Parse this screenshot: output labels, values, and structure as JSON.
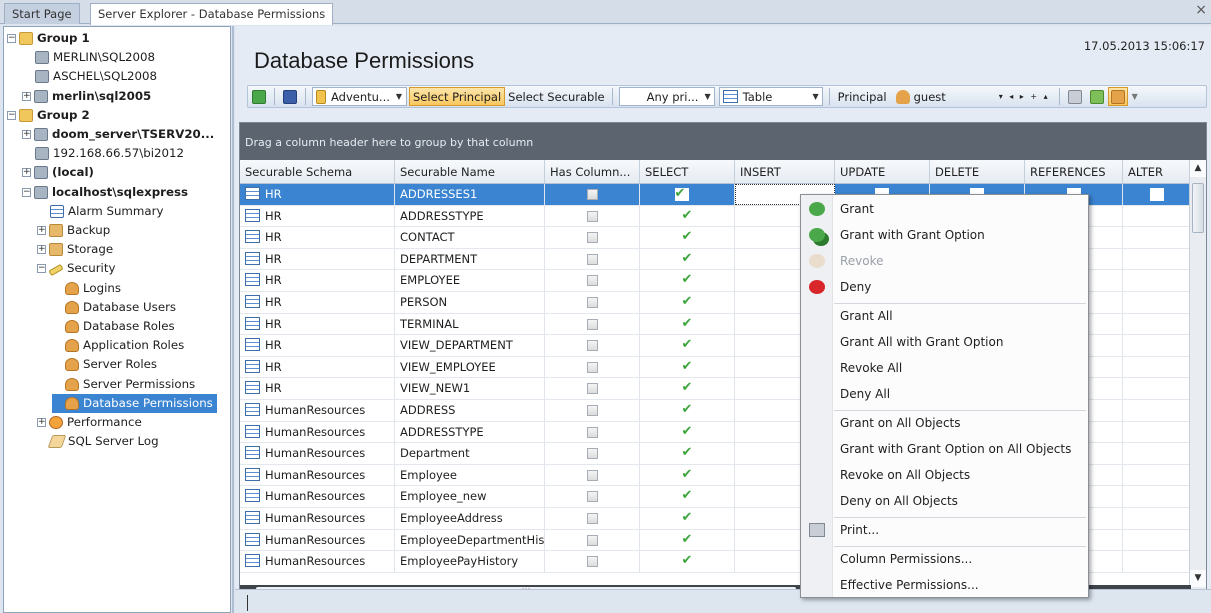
{
  "tabs": [
    {
      "label": "Start Page",
      "active": false
    },
    {
      "label": "Server Explorer - Database Permissions",
      "active": true
    }
  ],
  "tab_close_icon": "×",
  "tree": [
    {
      "label": "Group 1",
      "level": 0,
      "icon": "folder",
      "bold": true,
      "exp": "−"
    },
    {
      "label": "MERLIN\\SQL2008",
      "level": 1,
      "icon": "server",
      "bold": false,
      "exp": ""
    },
    {
      "label": "ASCHEL\\SQL2008",
      "level": 1,
      "icon": "server",
      "bold": false,
      "exp": ""
    },
    {
      "label": "merlin\\sql2005",
      "level": 1,
      "icon": "server",
      "bold": true,
      "exp": "+"
    },
    {
      "label": "Group 2",
      "level": 0,
      "icon": "folder",
      "bold": true,
      "exp": "−"
    },
    {
      "label": "doom_server\\TSERV20...",
      "level": 1,
      "icon": "server",
      "bold": true,
      "exp": "+"
    },
    {
      "label": "192.168.66.57\\bi2012",
      "level": 1,
      "icon": "server",
      "bold": false,
      "exp": ""
    },
    {
      "label": "(local)",
      "level": 1,
      "icon": "server",
      "bold": true,
      "exp": "+"
    },
    {
      "label": "localhost\\sqlexpress",
      "level": 1,
      "icon": "server",
      "bold": true,
      "exp": "−"
    },
    {
      "label": "Alarm Summary",
      "level": 2,
      "icon": "grid",
      "bold": false,
      "exp": ""
    },
    {
      "label": "Backup",
      "level": 2,
      "icon": "dbfold",
      "bold": false,
      "exp": "+"
    },
    {
      "label": "Storage",
      "level": 2,
      "icon": "dbfold",
      "bold": false,
      "exp": "+"
    },
    {
      "label": "Security",
      "level": 2,
      "icon": "key",
      "bold": false,
      "exp": "−"
    },
    {
      "label": "Logins",
      "level": 3,
      "icon": "user",
      "bold": false,
      "exp": ""
    },
    {
      "label": "Database Users",
      "level": 3,
      "icon": "user",
      "bold": false,
      "exp": ""
    },
    {
      "label": "Database Roles",
      "level": 3,
      "icon": "user",
      "bold": false,
      "exp": ""
    },
    {
      "label": "Application Roles",
      "level": 3,
      "icon": "user",
      "bold": false,
      "exp": ""
    },
    {
      "label": "Server Roles",
      "level": 3,
      "icon": "user",
      "bold": false,
      "exp": ""
    },
    {
      "label": "Server Permissions",
      "level": 3,
      "icon": "user",
      "bold": false,
      "exp": ""
    },
    {
      "label": "Database Permissions",
      "level": 3,
      "icon": "user",
      "bold": false,
      "exp": "",
      "selected": true
    },
    {
      "label": "Performance",
      "level": 2,
      "icon": "gear",
      "bold": false,
      "exp": "+"
    },
    {
      "label": "SQL Server Log",
      "level": 2,
      "icon": "pencil",
      "bold": false,
      "exp": ""
    }
  ],
  "main": {
    "title": "Database Permissions",
    "datetime": "17.05.2013 15:06:17"
  },
  "toolbar": {
    "database_combo": "Adventu...",
    "select_principal": "Select Principal",
    "select_securable": "Select Securable",
    "any_principal_combo": "Any pri...",
    "object_type_combo": "Table",
    "principal_label": "Principal",
    "principal_combo": "guest",
    "nav_arrows": "▾ ◂ ▸ + ▴"
  },
  "grid": {
    "group_panel_text": "Drag a column header here to group by that column",
    "columns": [
      "Securable Schema",
      "Securable Name",
      "Has Column...",
      "SELECT",
      "INSERT",
      "UPDATE",
      "DELETE",
      "REFERENCES",
      "ALTER"
    ],
    "rows": [
      {
        "schema": "HR",
        "name": "ADDRESSES1",
        "select": "✔",
        "insert": ""
      },
      {
        "schema": "HR",
        "name": "ADDRESSTYPE",
        "select": "✔",
        "insert": "✖"
      },
      {
        "schema": "HR",
        "name": "CONTACT",
        "select": "✔",
        "insert": ""
      },
      {
        "schema": "HR",
        "name": "DEPARTMENT",
        "select": "✔",
        "insert": ""
      },
      {
        "schema": "HR",
        "name": "EMPLOYEE",
        "select": "✔",
        "insert": ""
      },
      {
        "schema": "HR",
        "name": "PERSON",
        "select": "✔",
        "insert": ""
      },
      {
        "schema": "HR",
        "name": "TERMINAL",
        "select": "✔",
        "insert": ""
      },
      {
        "schema": "HR",
        "name": "VIEW_DEPARTMENT",
        "select": "✔",
        "insert": ""
      },
      {
        "schema": "HR",
        "name": "VIEW_EMPLOYEE",
        "select": "✔",
        "insert": ""
      },
      {
        "schema": "HR",
        "name": "VIEW_NEW1",
        "select": "✔",
        "insert": ""
      },
      {
        "schema": "HumanResources",
        "name": "ADDRESS",
        "select": "✔",
        "insert": ""
      },
      {
        "schema": "HumanResources",
        "name": "ADDRESSTYPE",
        "select": "✔",
        "insert": ""
      },
      {
        "schema": "HumanResources",
        "name": "Department",
        "select": "✔",
        "insert": ""
      },
      {
        "schema": "HumanResources",
        "name": "Employee",
        "select": "✔",
        "insert": ""
      },
      {
        "schema": "HumanResources",
        "name": "Employee_new",
        "select": "✔",
        "insert": ""
      },
      {
        "schema": "HumanResources",
        "name": "EmployeeAddress",
        "select": "✔",
        "insert": ""
      },
      {
        "schema": "HumanResources",
        "name": "EmployeeDepartmentHist...",
        "select": "✔",
        "insert": ""
      },
      {
        "schema": "HumanResources",
        "name": "EmployeePayHistory",
        "select": "✔",
        "insert": ""
      }
    ],
    "selected_row": 0
  },
  "context_menu": {
    "items": [
      {
        "label": "Grant",
        "icon": "grant-icon",
        "disabled": false
      },
      {
        "label": "Grant with Grant Option",
        "icon": "grant-with-option-icon",
        "disabled": false
      },
      {
        "label": "Revoke",
        "icon": "revoke-icon",
        "disabled": true
      },
      {
        "label": "Deny",
        "icon": "deny-icon",
        "disabled": false
      },
      {
        "sep": true
      },
      {
        "label": "Grant All",
        "disabled": false
      },
      {
        "label": "Grant All with Grant Option",
        "disabled": false
      },
      {
        "label": "Revoke All",
        "disabled": false
      },
      {
        "label": "Deny All",
        "disabled": false
      },
      {
        "sep": true
      },
      {
        "label": "Grant on All Objects",
        "disabled": false
      },
      {
        "label": "Grant with Grant Option on All Objects",
        "disabled": false
      },
      {
        "label": "Revoke on All Objects",
        "disabled": false
      },
      {
        "label": "Deny on All Objects",
        "disabled": false
      },
      {
        "sep": true
      },
      {
        "label": "Print...",
        "icon": "printer-icon",
        "disabled": false
      },
      {
        "sep": true
      },
      {
        "label": "Column Permissions...",
        "disabled": false
      },
      {
        "label": "Effective Permissions...",
        "disabled": false
      }
    ]
  },
  "colors": {
    "selection": "#3a84d1",
    "check_green": "#3aa33a",
    "deny_red": "#d8262a"
  }
}
